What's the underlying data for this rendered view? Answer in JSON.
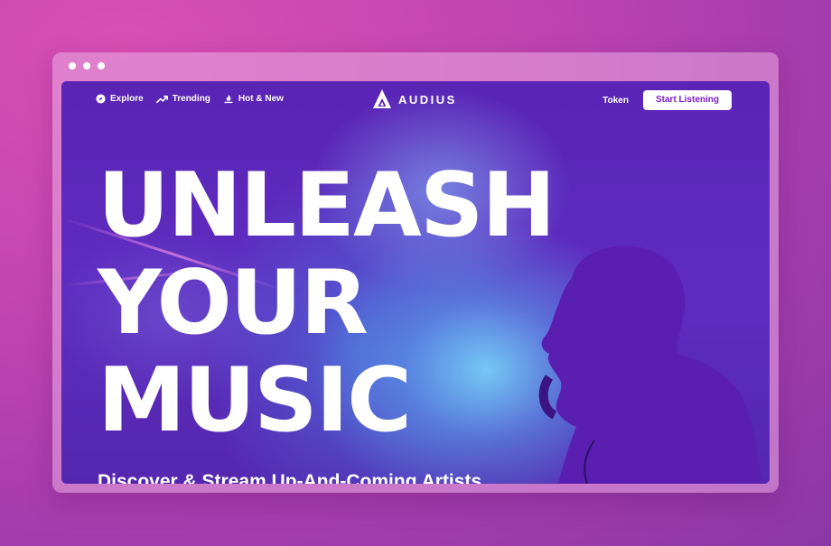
{
  "colors": {
    "page_background": "#c546b1",
    "hero_purple": "#5a22b8",
    "cta_text": "#7e1bcc",
    "white": "#ffffff"
  },
  "window": {
    "controls": [
      "dot",
      "dot",
      "dot"
    ]
  },
  "nav": {
    "left_links": [
      {
        "label": "Explore",
        "icon": "compass-icon"
      },
      {
        "label": "Trending",
        "icon": "trending-up-icon"
      },
      {
        "label": "Hot & New",
        "icon": "hot-new-icon"
      }
    ],
    "logo_text": "AUDIUS",
    "token_label": "Token",
    "cta_label": "Start Listening"
  },
  "hero": {
    "headline_lines": [
      "UNLEASH",
      "YOUR",
      "MUSIC"
    ],
    "subheadline": "Discover & Stream Up-And-Coming Artists"
  }
}
